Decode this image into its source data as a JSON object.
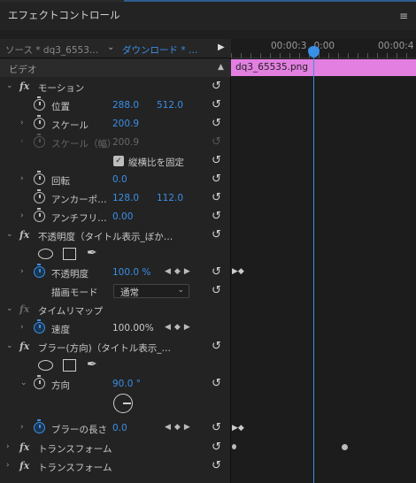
{
  "panel": {
    "title": "エフェクトコントロール",
    "menu_icon": "hamburger-icon"
  },
  "source": {
    "source_label": "ソース * dq3_6553…",
    "clip_label": "ダウンロード * …"
  },
  "video_header": "ビデオ",
  "timeline": {
    "time1": "00:00:3",
    "time1b": "0:00",
    "time2": "00:00:4",
    "clip_name": "dq3_65535.png"
  },
  "motion": {
    "name": "モーション",
    "position": {
      "label": "位置",
      "x": "288.0",
      "y": "512.0"
    },
    "scale": {
      "label": "スケール",
      "value": "200.9"
    },
    "scale_w": {
      "label": "スケール（幅）",
      "value": "200.9"
    },
    "uniform": {
      "label": "縦横比を固定",
      "checked": true
    },
    "rotation": {
      "label": "回転",
      "value": "0.0"
    },
    "anchor": {
      "label": "アンカーポ…",
      "x": "128.0",
      "y": "112.0"
    },
    "antiflicker": {
      "label": "アンチフリ…",
      "value": "0.00"
    }
  },
  "opacity": {
    "name": "不透明度（タイトル表示_ぼか…",
    "opacity": {
      "label": "不透明度",
      "value": "100.0 %"
    },
    "blend": {
      "label": "描画モード",
      "value": "通常"
    }
  },
  "timeremap": {
    "name": "タイムリマップ",
    "speed": {
      "label": "速度",
      "value": "100.00%"
    }
  },
  "blur": {
    "name": "ブラー(方向)（タイトル表示_…",
    "direction": {
      "label": "方向",
      "value": "90.0 °"
    },
    "length": {
      "label": "ブラーの長さ",
      "value": "0.0"
    }
  },
  "transform1": {
    "name": "トランスフォーム"
  },
  "transform2": {
    "name": "トランスフォーム"
  },
  "colors": {
    "accent": "#3a8fe6",
    "clip": "#e27fe0"
  }
}
